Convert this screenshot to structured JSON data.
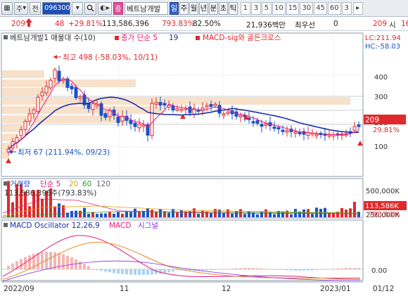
{
  "toolbar": {
    "code_prefix_1": "▦",
    "code_prefix_2": "주",
    "dropdown_1": "▾",
    "code_type": "전",
    "code": "096300",
    "dropdown_2": "▾",
    "search_icon": "search-icon",
    "arrow_icon": "◐▸",
    "stock_badge": "증",
    "stock_name": "베트남개발",
    "periods": [
      "일",
      "주",
      "월",
      "년",
      "분",
      "초",
      "틱"
    ],
    "active_period": "일",
    "intervals": [
      "1",
      "3",
      "5",
      "10",
      "15",
      "30",
      "45",
      "60",
      "3"
    ],
    "more": "▸"
  },
  "info": {
    "price": "209",
    "change": "48",
    "change_pct": "+29.81%",
    "volume": "113,586,396",
    "volume_pct": "793.83%",
    "ratio": "82.50%",
    "amount": "21,936백만",
    "best_bid_label": "최우선",
    "best_bid_value": "0",
    "last_price": "209",
    "open_label": "시",
    "open_value": "16"
  },
  "panels": {
    "price": {
      "legend_name": "베트남개발1 매물대 수(10)",
      "legend_ma": "종가 단순 5",
      "legend_ma_2": "19",
      "legend_macd": "MACD-sig와 골든크로스",
      "lc": "LC:211.94",
      "hc": "HC:-58.03",
      "high_label": "최고 498 (-58.03%, 10/11)",
      "low_label": "최저 67 (211.94%, 09/23)",
      "price_tag": "209",
      "pct_tag": "29.81%",
      "yticks": [
        "400",
        "300",
        "200",
        "100"
      ]
    },
    "volume": {
      "legend_name": "거래량",
      "legend_ma": [
        "단순 5",
        "20",
        "60",
        "120"
      ],
      "value_label": "113,586,396주(793.83%)",
      "tag_value": "113,586K",
      "tag_pct": "793.83%",
      "yticks": [
        "500,000K",
        "250,000K"
      ]
    },
    "macd": {
      "legend_osc": "MACD Oscillator 12,26,9",
      "legend_macd": "MACD",
      "legend_sig": "시그널",
      "yticks": [
        "0.00"
      ]
    }
  },
  "xaxis": [
    "2022/09",
    "11",
    "12",
    "2023/01",
    "01/12"
  ],
  "colors": {
    "up": "#e0292c",
    "down": "#1a52c7",
    "ma5": "#e6197c",
    "ma20": "#1b2fa8",
    "profile": "#f7e1cb"
  }
}
